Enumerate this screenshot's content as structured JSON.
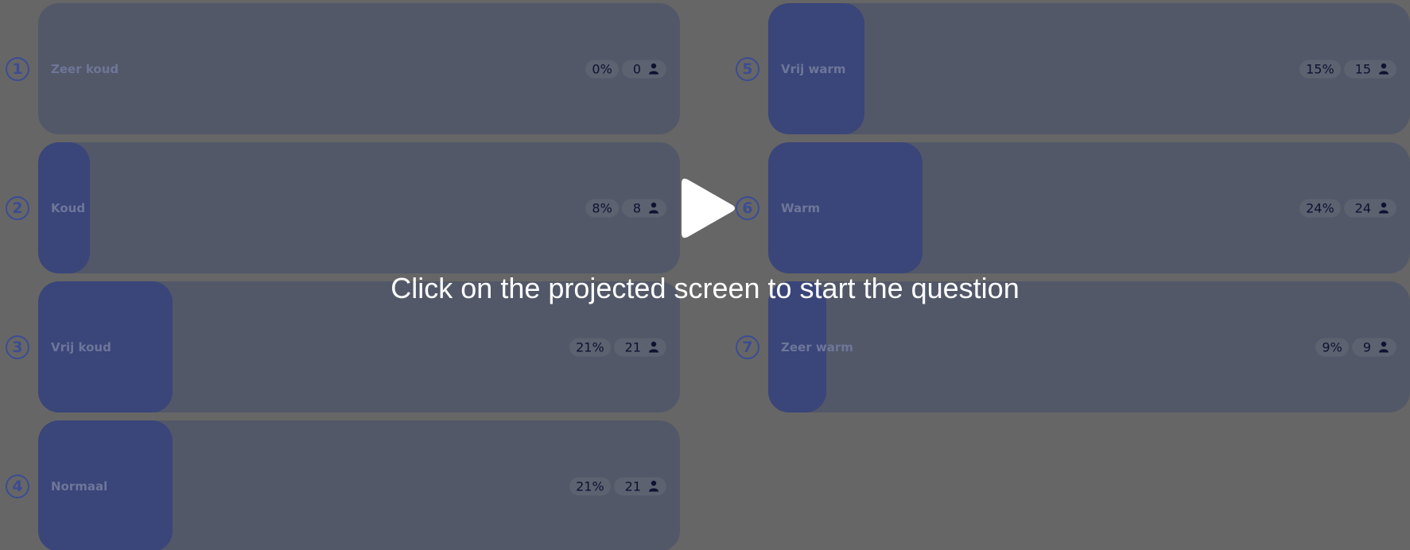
{
  "options": [
    {
      "number": "1",
      "label": "Zeer koud",
      "percent_label": "0%",
      "count": "0",
      "fraction": 0.0
    },
    {
      "number": "2",
      "label": "Koud",
      "percent_label": "8%",
      "count": "8",
      "fraction": 0.08
    },
    {
      "number": "3",
      "label": "Vrij koud",
      "percent_label": "21%",
      "count": "21",
      "fraction": 0.21
    },
    {
      "number": "4",
      "label": "Normaal",
      "percent_label": "21%",
      "count": "21",
      "fraction": 0.21
    },
    {
      "number": "5",
      "label": "Vrij warm",
      "percent_label": "15%",
      "count": "15",
      "fraction": 0.15
    },
    {
      "number": "6",
      "label": "Warm",
      "percent_label": "24%",
      "count": "24",
      "fraction": 0.24
    },
    {
      "number": "7",
      "label": "Zeer warm",
      "percent_label": "9%",
      "count": "9",
      "fraction": 0.09
    }
  ],
  "overlay": {
    "caption": "Click on the projected screen to start the question",
    "play_icon": "play-icon"
  },
  "colors": {
    "background": "#666666",
    "bar_track": "#525868",
    "bar_fill": "#3a457a",
    "accent": "#3c4c94"
  },
  "icons": {
    "respondent_icon": "person-icon"
  }
}
